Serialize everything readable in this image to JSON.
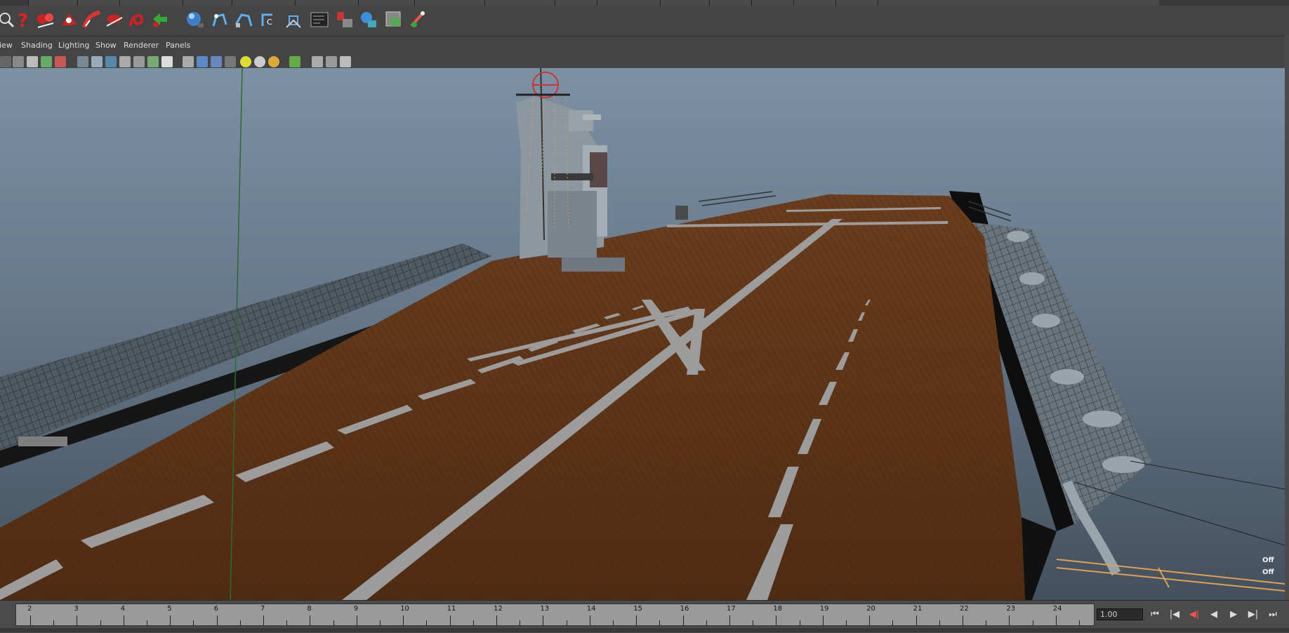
{
  "panel_menu": {
    "view": "iew",
    "shading": "Shading",
    "lighting": "Lighting",
    "show": "Show",
    "renderer": "Renderer",
    "panels": "Panels"
  },
  "shelf_icons": [
    "select-tool-icon",
    "help-icon",
    "paint-effects-icon",
    "sculpt-icon",
    "brush-icon",
    "stroke-icon",
    "lasso-icon",
    "arrow-icon",
    "sphere-icon",
    "joint-icon",
    "ik-handle-icon",
    "cluster-icon",
    "lattice-icon",
    "graph-editor-icon",
    "render-icon",
    "ipr-render-icon",
    "render-settings-icon",
    "hypershade-icon"
  ],
  "timeline": {
    "ticks": [
      "2",
      "3",
      "4",
      "5",
      "6",
      "7",
      "8",
      "9",
      "10",
      "11",
      "12",
      "13",
      "14",
      "15",
      "16",
      "17",
      "18",
      "19",
      "20",
      "21",
      "22",
      "23",
      "24"
    ],
    "current_frame": "1.00"
  },
  "playback": {
    "go_start": "⏮",
    "step_back_key": "|◀",
    "prev_frame": "◀|",
    "play_back": "◀",
    "play_forward": "▶",
    "next_frame": "▶|",
    "go_end": "⏭"
  },
  "hud": {
    "value1": "Off",
    "value2": "Off"
  },
  "colors": {
    "sky_top": "#7d91a4",
    "sky_bottom": "#43505e",
    "deck": "#5a3419",
    "deck_marking": "#9c9c9c",
    "ui_bg": "#444444"
  }
}
